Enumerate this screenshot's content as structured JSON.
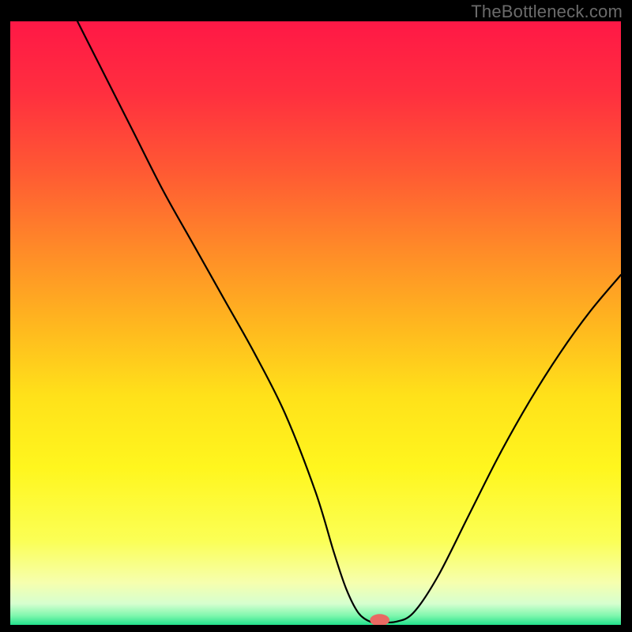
{
  "watermark": "TheBottleneck.com",
  "chart_data": {
    "type": "line",
    "title": "",
    "xlabel": "",
    "ylabel": "",
    "xlim": [
      0,
      100
    ],
    "ylim": [
      0,
      100
    ],
    "grid": false,
    "legend": false,
    "gradient_stops": [
      {
        "offset": 0.0,
        "color": "#ff1846"
      },
      {
        "offset": 0.12,
        "color": "#ff2f3f"
      },
      {
        "offset": 0.25,
        "color": "#ff5a33"
      },
      {
        "offset": 0.38,
        "color": "#ff8b28"
      },
      {
        "offset": 0.5,
        "color": "#ffb61f"
      },
      {
        "offset": 0.62,
        "color": "#ffe11a"
      },
      {
        "offset": 0.74,
        "color": "#fff61e"
      },
      {
        "offset": 0.86,
        "color": "#fbff55"
      },
      {
        "offset": 0.93,
        "color": "#f6ffae"
      },
      {
        "offset": 0.965,
        "color": "#d6ffcf"
      },
      {
        "offset": 0.985,
        "color": "#7ef7ad"
      },
      {
        "offset": 1.0,
        "color": "#22e08a"
      }
    ],
    "series": [
      {
        "name": "bottleneck-curve",
        "color": "#000000",
        "width": 2.2,
        "x": [
          11,
          15,
          20,
          25,
          30,
          35,
          40,
          45,
          50,
          53,
          55,
          57,
          59,
          60,
          63,
          66,
          70,
          75,
          80,
          85,
          90,
          95,
          100
        ],
        "y": [
          100,
          92,
          82,
          72,
          63,
          54,
          45,
          35,
          22,
          12,
          6,
          2,
          0.5,
          0.5,
          0.5,
          2,
          8,
          18,
          28,
          37,
          45,
          52,
          58
        ]
      }
    ],
    "marker": {
      "name": "optimal-point",
      "x": 60.5,
      "y": 0.8,
      "rx": 1.6,
      "ry": 1.0,
      "fill": "#e96a63"
    }
  }
}
